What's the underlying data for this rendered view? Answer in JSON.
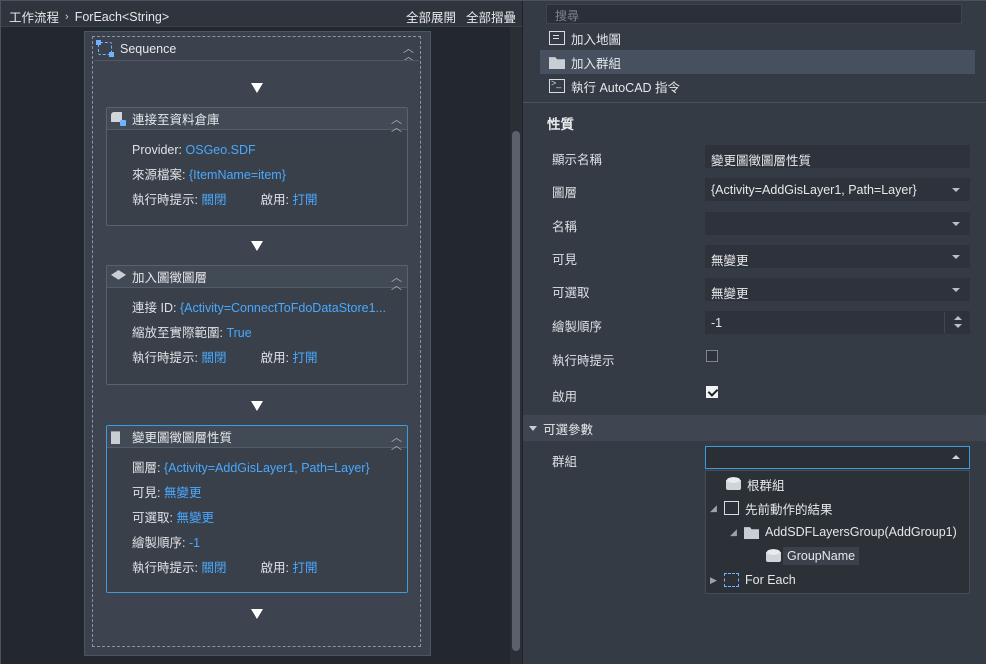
{
  "breadcrumb": {
    "root": "工作流程",
    "separator": "›",
    "current": "ForEach<String>"
  },
  "left_toolbar": {
    "expand_all": "全部展開",
    "collapse_all": "全部摺疊"
  },
  "sequence": {
    "title": "Sequence",
    "activities": [
      {
        "name": "連接至資料倉庫",
        "icon": "database-connect-icon",
        "rows": [
          {
            "label": "Provider:",
            "value": "OSGeo.SDF"
          },
          {
            "label": "來源檔案:",
            "value": "{ItemName=item}"
          }
        ],
        "runtime_hint_label": "執行時提示:",
        "runtime_hint_value": "關閉",
        "enabled_label": "啟用:",
        "enabled_value": "打開"
      },
      {
        "name": "加入圖徵圖層",
        "icon": "add-layer-icon",
        "rows": [
          {
            "label": "連接 ID:",
            "value": "{Activity=ConnectToFdoDataStore1..."
          },
          {
            "label": "縮放至實際範圍:",
            "value": "True"
          }
        ],
        "runtime_hint_label": "執行時提示:",
        "runtime_hint_value": "關閉",
        "enabled_label": "啟用:",
        "enabled_value": "打開"
      },
      {
        "name": "變更圖徵圖層性質",
        "icon": "layer-properties-icon",
        "rows": [
          {
            "label": "圖層:",
            "value": "{Activity=AddGisLayer1, Path=Layer}"
          },
          {
            "label": "可見:",
            "value": "無變更"
          },
          {
            "label": "可選取:",
            "value": "無變更"
          },
          {
            "label": "繪製順序:",
            "value": "-1"
          }
        ],
        "runtime_hint_label": "執行時提示:",
        "runtime_hint_value": "關閉",
        "enabled_label": "啟用:",
        "enabled_value": "打開"
      }
    ]
  },
  "toolbox": {
    "search_placeholder": "搜尋",
    "items": [
      {
        "label": "加入地圖",
        "icon": "add-map-icon"
      },
      {
        "label": "加入群組",
        "icon": "add-group-icon",
        "active": true
      },
      {
        "label": "執行 AutoCAD 指令",
        "icon": "autocad-command-icon"
      }
    ]
  },
  "properties": {
    "title": "性質",
    "display_name": {
      "label": "顯示名稱",
      "value": "變更圖徵圖層性質"
    },
    "layer": {
      "label": "圖層",
      "value": "{Activity=AddGisLayer1, Path=Layer}"
    },
    "name": {
      "label": "名稱",
      "value": ""
    },
    "visible": {
      "label": "可見",
      "value": "無變更"
    },
    "selectable": {
      "label": "可選取",
      "value": "無變更"
    },
    "draw_order": {
      "label": "繪製順序",
      "value": "-1"
    },
    "runtime_hint": {
      "label": "執行時提示",
      "checked": false
    },
    "enabled": {
      "label": "啟用",
      "checked": true
    }
  },
  "optional_params": {
    "title": "可選參數",
    "group": {
      "label": "群組",
      "value": ""
    },
    "tree": {
      "root_group": "根群組",
      "previous_results": "先前動作的結果",
      "add_group_result": "AddSDFLayersGroup(AddGroup1)",
      "group_name": "GroupName",
      "for_each": "For Each"
    }
  },
  "colors": {
    "accent": "#3d9ce0",
    "value_blue": "#4aa8ff"
  }
}
